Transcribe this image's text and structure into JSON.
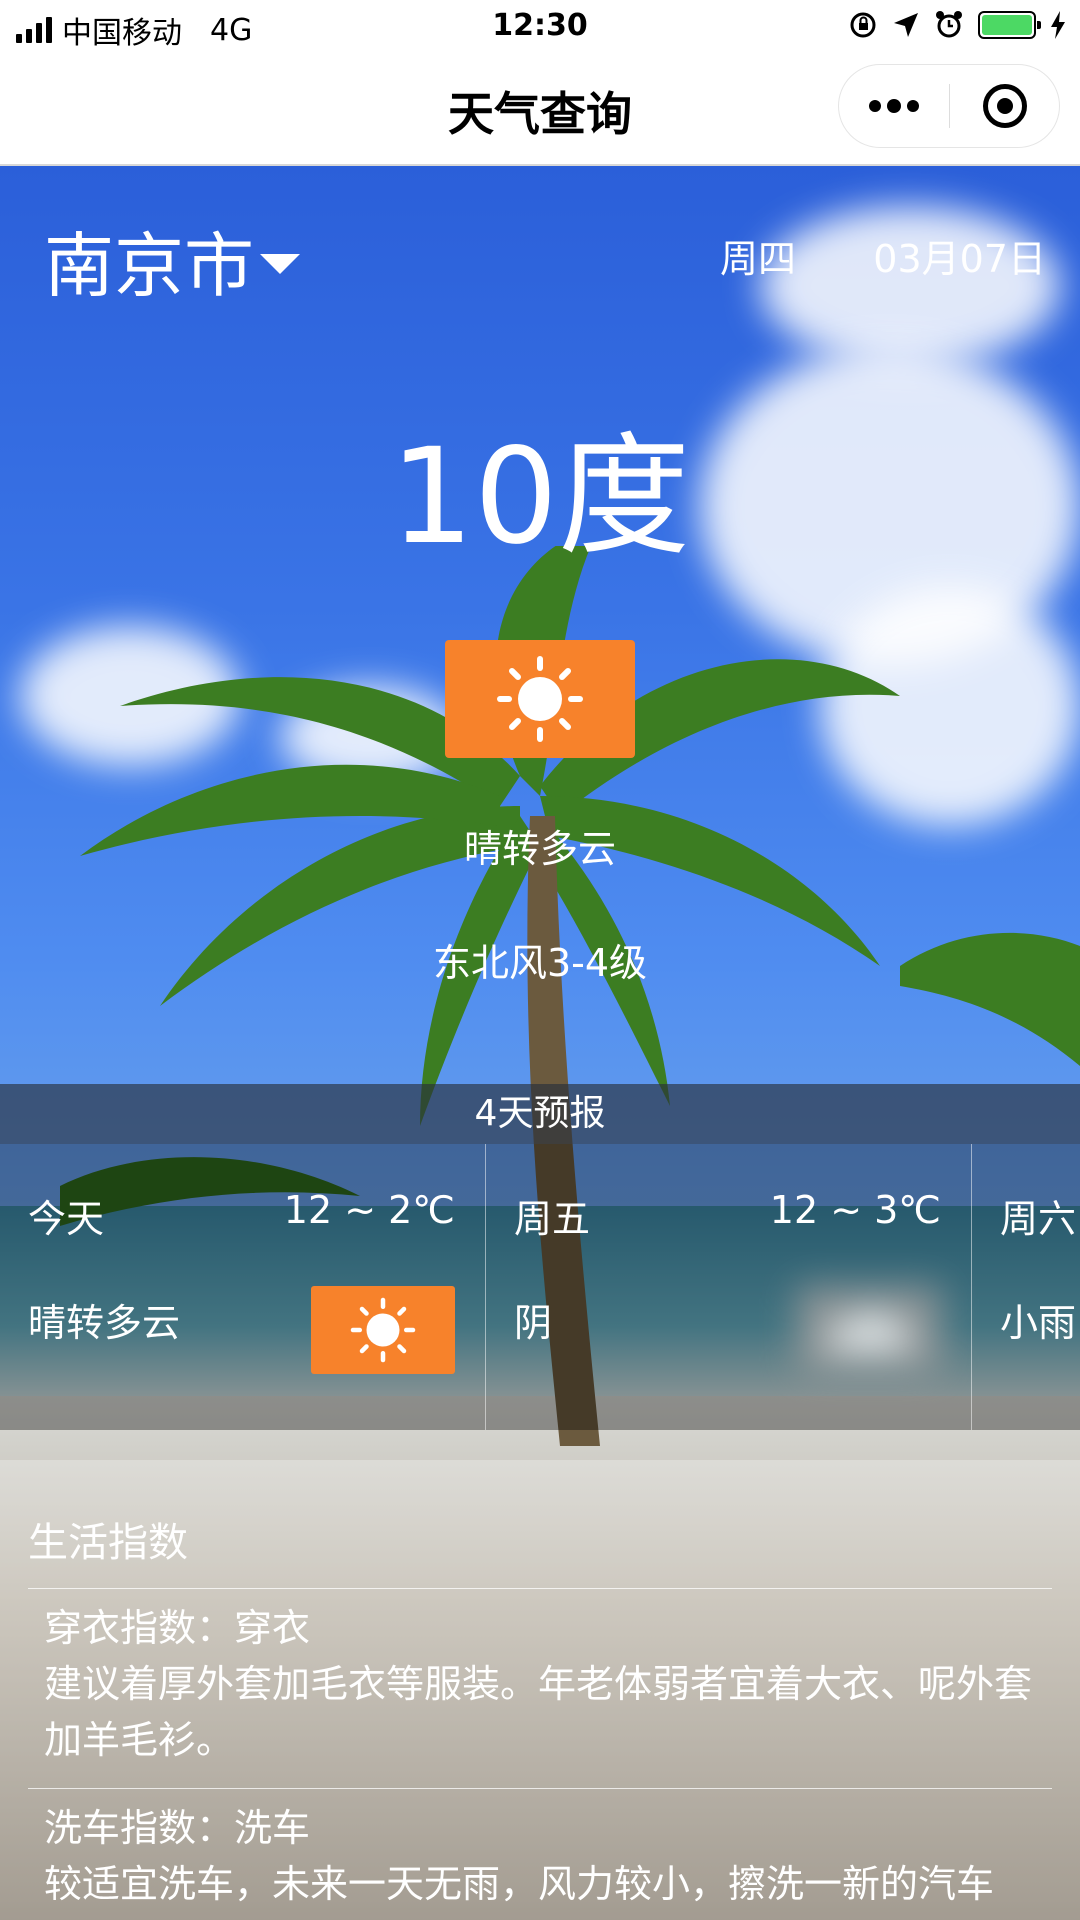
{
  "status_bar": {
    "carrier": "中国移动",
    "network": "4G",
    "time": "12:30"
  },
  "nav": {
    "title": "天气查询"
  },
  "current": {
    "city": "南京市",
    "weekday": "周四",
    "date": "03月07日",
    "temperature": "10度",
    "icon": "sun-icon",
    "condition": "晴转多云",
    "wind": "东北风3-4级"
  },
  "forecast": {
    "title": "4天预报",
    "days": [
      {
        "day": "今天",
        "range": "12 ~ 2℃",
        "condition": "晴转多云",
        "icon": "sun-icon"
      },
      {
        "day": "周五",
        "range": "12 ~ 3℃",
        "condition": "阴",
        "icon": "cloud-icon"
      },
      {
        "day": "周六",
        "range": "",
        "condition": "小雨",
        "icon": "rain-icon"
      }
    ]
  },
  "life_index": {
    "title": "生活指数",
    "items": [
      {
        "name": "穿衣指数：穿衣",
        "desc": "建议着厚外套加毛衣等服装。年老体弱者宜着大衣、呢外套加羊毛衫。"
      },
      {
        "name": "洗车指数：洗车",
        "desc": "较适宜洗车，未来一天无雨，风力较小，擦洗一新的汽车"
      }
    ]
  },
  "colors": {
    "sun_icon_bg": "#f7822b",
    "cloud_icon_bg": "#9a9a9a",
    "battery": "#4cd964"
  }
}
